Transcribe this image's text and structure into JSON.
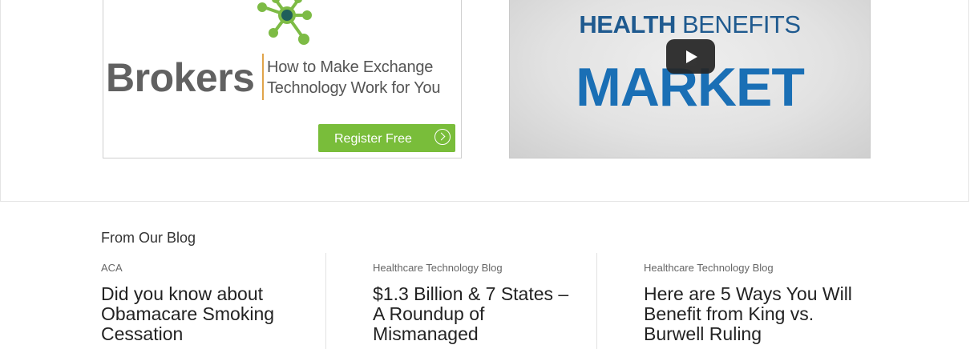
{
  "ad": {
    "brand_word": "Brokers",
    "tagline_line1": "How to Make Exchange",
    "tagline_line2": "Technology Work for You",
    "cta_label": "Register Free",
    "colors": {
      "accent": "#79bd3a",
      "divider": "#e0a44a",
      "molecule_center": "#1f5f5b"
    }
  },
  "video": {
    "title_bold": "HEALTH",
    "title_light": "BENEFITS",
    "title_main": "MARKET",
    "play_icon": "play-icon"
  },
  "blog": {
    "heading": "From Our Blog",
    "posts": [
      {
        "category": "ACA",
        "title": "Did you know about Obamacare Smoking Cessation"
      },
      {
        "category": "Healthcare Technology Blog",
        "title": "$1.3 Billion & 7 States – A Roundup of Mismanaged"
      },
      {
        "category": "Healthcare Technology Blog",
        "title": "Here are 5 Ways You Will Benefit from King vs. Burwell Ruling"
      }
    ]
  }
}
